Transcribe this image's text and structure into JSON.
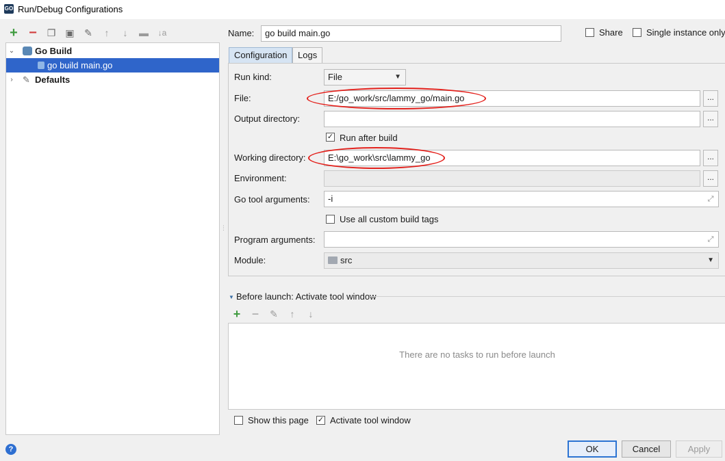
{
  "window": {
    "title": "Run/Debug Configurations",
    "icon": "goland-app-icon"
  },
  "toolbar": {
    "icons": [
      "add-icon",
      "remove-icon",
      "copy-icon",
      "save-icon",
      "edit-defaults-icon",
      "move-up-icon",
      "move-down-icon",
      "folder-icon",
      "sort-icon"
    ]
  },
  "tree": {
    "go_build": "Go Build",
    "go_build_main": "go build main.go",
    "defaults": "Defaults"
  },
  "form": {
    "name_label": "Name:",
    "name_value": "go build main.go",
    "share_label": "Share",
    "single_instance_label": "Single instance only",
    "tabs": [
      "Configuration",
      "Logs"
    ],
    "run_kind_label": "Run kind:",
    "run_kind_value": "File",
    "file_label": "File:",
    "file_value": "E:/go_work/src/lammy_go/main.go",
    "output_dir_label": "Output directory:",
    "output_dir_value": "",
    "run_after_build_label": "Run after build",
    "run_after_build_checked": true,
    "working_dir_label": "Working directory:",
    "working_dir_value": "E:\\go_work\\src\\lammy_go",
    "environment_label": "Environment:",
    "go_tool_args_label": "Go tool arguments:",
    "go_tool_args_value": "-i",
    "custom_build_tags_label": "Use all custom build tags",
    "custom_build_tags_checked": false,
    "program_args_label": "Program arguments:",
    "module_label": "Module:",
    "module_value": "src",
    "browse_label": "..."
  },
  "before_launch": {
    "title": "Before launch: Activate tool window",
    "empty_text": "There are no tasks to run before launch",
    "icons": [
      "add-icon",
      "remove-icon",
      "edit-icon",
      "move-up-icon",
      "move-down-icon"
    ]
  },
  "footer": {
    "show_this_page_label": "Show this page",
    "show_this_page_checked": false,
    "activate_tool_window_label": "Activate tool window",
    "activate_tool_window_checked": true,
    "ok_label": "OK",
    "cancel_label": "Cancel",
    "apply_label": "Apply"
  },
  "colors": {
    "selection": "#2f65ca",
    "annotation_red": "#e3201b",
    "tab_active": "#d6e4f3"
  }
}
